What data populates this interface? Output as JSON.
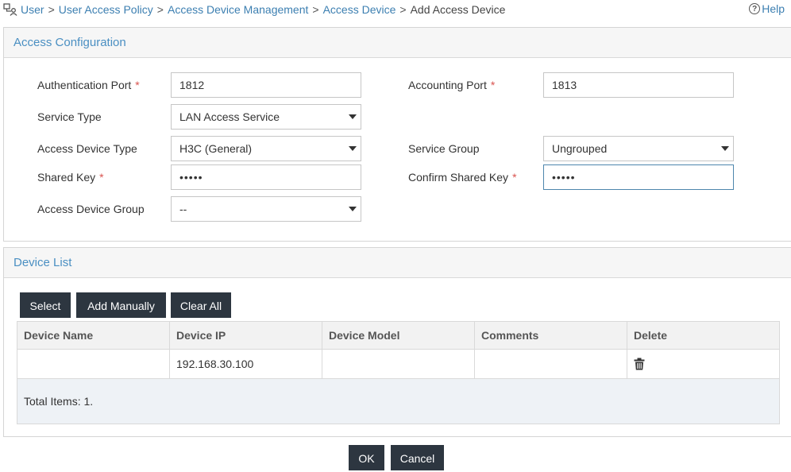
{
  "breadcrumb": {
    "items": [
      "User",
      "User Access Policy",
      "Access Device Management",
      "Access Device"
    ],
    "separator": ">",
    "current": "Add Access Device"
  },
  "help": {
    "icon": "question-circle-icon",
    "label": "Help"
  },
  "access_config": {
    "title": "Access Configuration",
    "required_mark": "*",
    "auth_port": {
      "label": "Authentication Port",
      "value": "1812"
    },
    "acct_port": {
      "label": "Accounting Port",
      "value": "1813"
    },
    "service_type": {
      "label": "Service Type",
      "value": "LAN Access Service"
    },
    "device_type": {
      "label": "Access Device Type",
      "value": "H3C (General)"
    },
    "service_group": {
      "label": "Service Group",
      "value": "Ungrouped"
    },
    "shared_key": {
      "label": "Shared Key",
      "value": "•••••"
    },
    "confirm_key": {
      "label": "Confirm Shared Key",
      "value": "•••••"
    },
    "device_group": {
      "label": "Access Device Group",
      "value": "--"
    }
  },
  "device_list": {
    "title": "Device List",
    "buttons": {
      "select": "Select",
      "add_manually": "Add Manually",
      "clear_all": "Clear All"
    },
    "columns": [
      "Device Name",
      "Device IP",
      "Device Model",
      "Comments",
      "Delete"
    ],
    "rows": [
      {
        "name": "",
        "ip": "192.168.30.100",
        "model": "",
        "comments": "",
        "delete_icon": "trash-icon"
      }
    ],
    "total": "Total Items: 1."
  },
  "actions": {
    "ok": "OK",
    "cancel": "Cancel"
  },
  "colors": {
    "link": "#3c7fb1",
    "panel_title": "#4a8fc2",
    "button_bg": "#2d3640",
    "required": "#d9534f"
  }
}
